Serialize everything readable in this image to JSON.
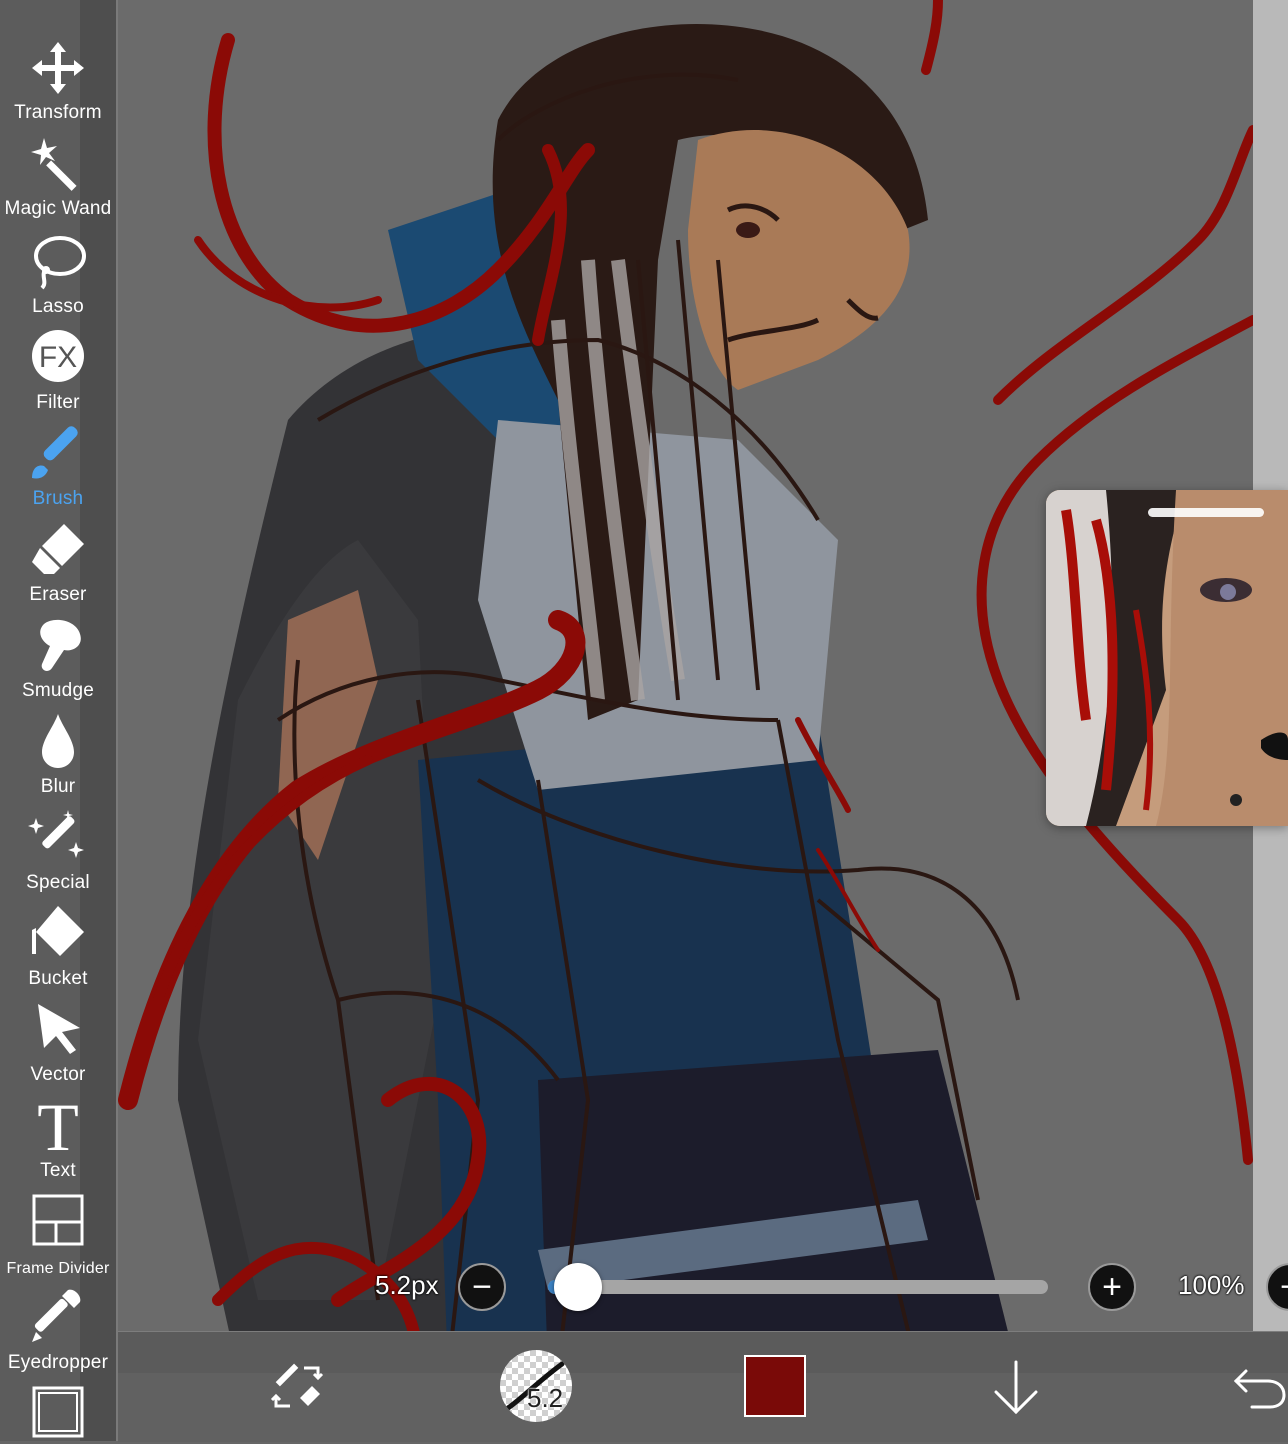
{
  "toolbar": {
    "tools": [
      {
        "label": "Transform",
        "icon": "transform-icon"
      },
      {
        "label": "Magic Wand",
        "icon": "magic-wand-icon"
      },
      {
        "label": "Lasso",
        "icon": "lasso-icon"
      },
      {
        "label": "Filter",
        "icon": "fx-icon",
        "icon_text": "FX"
      },
      {
        "label": "Brush",
        "icon": "brush-icon",
        "active": true
      },
      {
        "label": "Eraser",
        "icon": "eraser-icon"
      },
      {
        "label": "Smudge",
        "icon": "smudge-icon"
      },
      {
        "label": "Blur",
        "icon": "blur-drop-icon"
      },
      {
        "label": "Special",
        "icon": "special-icon"
      },
      {
        "label": "Bucket",
        "icon": "bucket-icon"
      },
      {
        "label": "Vector",
        "icon": "vector-cursor-icon"
      },
      {
        "label": "Text",
        "icon": "text-icon",
        "icon_text": "T"
      },
      {
        "label": "Frame Divider",
        "icon": "frame-divider-icon"
      },
      {
        "label": "Eyedropper",
        "icon": "eyedropper-icon"
      }
    ],
    "active_color": "#4ba3f0"
  },
  "slider": {
    "size_label": "5.2px",
    "size_fraction": 0.06,
    "opacity_label": "100%",
    "minus_symbol": "−",
    "plus_symbol": "+"
  },
  "bottom_bar": {
    "brush_size": "5.2",
    "current_color": "#7a0a08",
    "icons": [
      "swap-brush-eraser-icon",
      "brush-preview",
      "color-swatch",
      "download-arrow-icon",
      "undo-icon"
    ]
  },
  "colors": {
    "canvas_bg": "#6b6b6b",
    "stroke_red": "#8b0a06",
    "sketch_brown": "#2a1712",
    "coat_blue": "#1a4468"
  }
}
